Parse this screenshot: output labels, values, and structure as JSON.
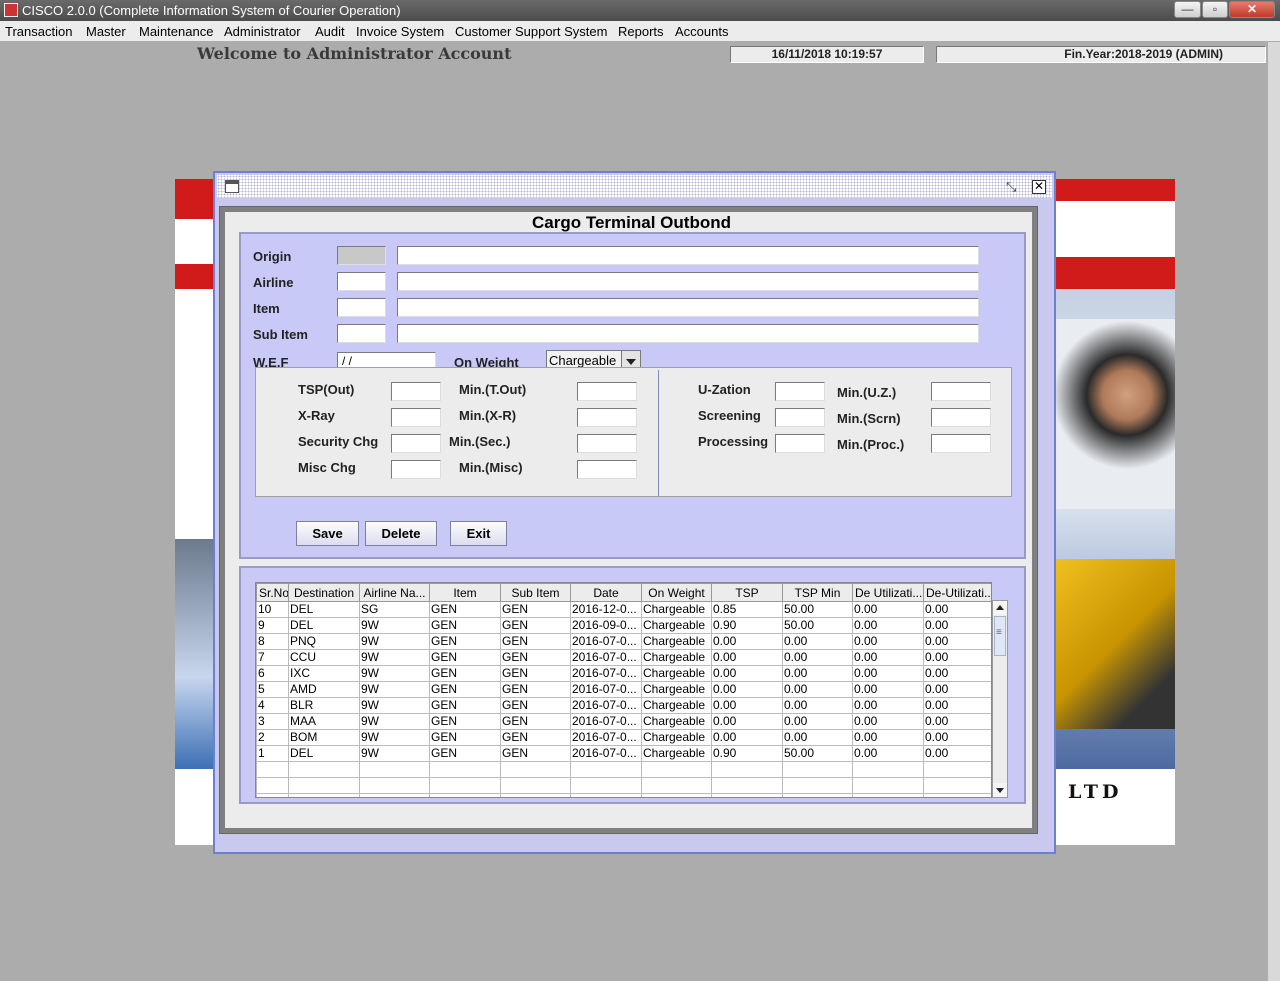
{
  "window": {
    "title": "CISCO 2.0.0 (Complete Information System of Courier Operation)",
    "minimize": "—",
    "maximize": "▫",
    "close": "✕"
  },
  "menu": [
    "Transaction",
    "Master",
    "Maintenance",
    "Administrator",
    "Audit",
    "Invoice System",
    "Customer Support System",
    "Reports",
    "Accounts"
  ],
  "welcome": "Welcome to Administrator Account",
  "status": {
    "datetime": "16/11/2018    10:19:57",
    "finyear": "Fin.Year:2018-2019  (ADMIN)"
  },
  "background": {
    "company_suffix": "LTD"
  },
  "colors": {
    "form_bg": "#c9c9f8",
    "frame_border": "#6f7fd0",
    "brand_red": "#d11b1b"
  },
  "dialog": {
    "title": "Cargo Terminal Outbond",
    "restore_icon": "restore-icon",
    "close_icon": "close-icon",
    "fields": {
      "origin_label": "Origin",
      "airline_label": "Airline",
      "item_label": "Item",
      "subitem_label": "Sub Item",
      "wef_label": "W.E.F",
      "wef_value": " / /",
      "on_weight_label": "On Weight",
      "on_weight_value": "Chargeable"
    },
    "rates": {
      "tsp_out": "TSP(Out)",
      "min_tout": "Min.(T.Out)",
      "xray": "X-Ray",
      "min_xr": "Min.(X-R)",
      "security_chg": "Security Chg",
      "min_sec": "Min.(Sec.)",
      "misc_chg": "Misc Chg",
      "min_misc": "Min.(Misc)",
      "uzation": "U-Zation",
      "min_uz": "Min.(U.Z.)",
      "screening": "Screening",
      "min_scrn": "Min.(Scrn)",
      "processing": "Processing",
      "min_proc": "Min.(Proc.)"
    },
    "buttons": {
      "save": "Save",
      "delete": "Delete",
      "exit": "Exit"
    },
    "table": {
      "columns": [
        "Sr.No",
        "Destination",
        "Airline Na...",
        "Item",
        "Sub Item",
        "Date",
        "On Weight",
        "TSP",
        "TSP Min",
        "De Utilizati...",
        "De-Utilizati..."
      ],
      "rows": [
        [
          "10",
          "DEL",
          "SG",
          "GEN",
          "GEN",
          "2016-12-0...",
          "Chargeable",
          "0.85",
          "50.00",
          "0.00",
          "0.00"
        ],
        [
          "9",
          "DEL",
          "9W",
          "GEN",
          "GEN",
          "2016-09-0...",
          "Chargeable",
          "0.90",
          "50.00",
          "0.00",
          "0.00"
        ],
        [
          "8",
          "PNQ",
          "9W",
          "GEN",
          "GEN",
          "2016-07-0...",
          "Chargeable",
          "0.00",
          "0.00",
          "0.00",
          "0.00"
        ],
        [
          "7",
          "CCU",
          "9W",
          "GEN",
          "GEN",
          "2016-07-0...",
          "Chargeable",
          "0.00",
          "0.00",
          "0.00",
          "0.00"
        ],
        [
          "6",
          "IXC",
          "9W",
          "GEN",
          "GEN",
          "2016-07-0...",
          "Chargeable",
          "0.00",
          "0.00",
          "0.00",
          "0.00"
        ],
        [
          "5",
          "AMD",
          "9W",
          "GEN",
          "GEN",
          "2016-07-0...",
          "Chargeable",
          "0.00",
          "0.00",
          "0.00",
          "0.00"
        ],
        [
          "4",
          "BLR",
          "9W",
          "GEN",
          "GEN",
          "2016-07-0...",
          "Chargeable",
          "0.00",
          "0.00",
          "0.00",
          "0.00"
        ],
        [
          "3",
          "MAA",
          "9W",
          "GEN",
          "GEN",
          "2016-07-0...",
          "Chargeable",
          "0.00",
          "0.00",
          "0.00",
          "0.00"
        ],
        [
          "2",
          "BOM",
          "9W",
          "GEN",
          "GEN",
          "2016-07-0...",
          "Chargeable",
          "0.00",
          "0.00",
          "0.00",
          "0.00"
        ],
        [
          "1",
          "DEL",
          "9W",
          "GEN",
          "GEN",
          "2016-07-0...",
          "Chargeable",
          "0.90",
          "50.00",
          "0.00",
          "0.00"
        ]
      ]
    }
  }
}
